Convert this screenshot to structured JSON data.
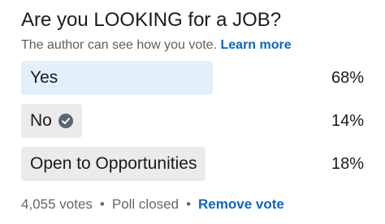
{
  "poll": {
    "question": "Are you LOOKING for a JOB?",
    "visibility_note": "The author can see how you vote.",
    "learn_more_label": "Learn more",
    "options": [
      {
        "label": "Yes",
        "percent_label": "68%",
        "percent": 68,
        "selected": false
      },
      {
        "label": "No",
        "percent_label": "14%",
        "percent": 14,
        "selected": true
      },
      {
        "label": "Open to Opportunities",
        "percent_label": "18%",
        "percent": 18,
        "selected": false
      }
    ],
    "votes_label": "4,055 votes",
    "separator": "•",
    "status_label": "Poll closed",
    "remove_vote_label": "Remove vote"
  },
  "colors": {
    "accent": "#0a66c2",
    "winning_bar": "#e3effa",
    "other_bar": "#ebebeb",
    "check_icon": "#5b6670"
  },
  "icons": {
    "selected_vote": "check-circle-icon"
  }
}
